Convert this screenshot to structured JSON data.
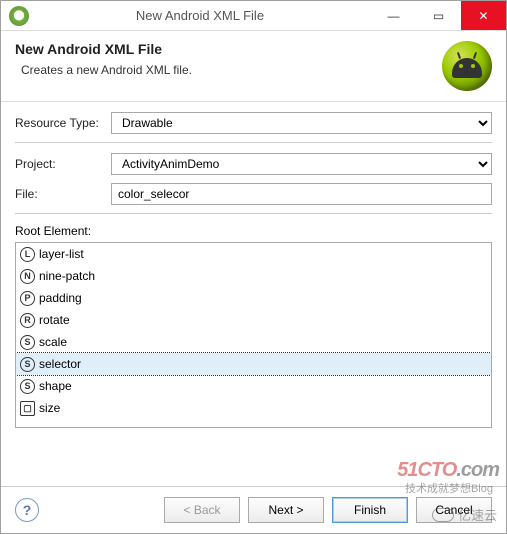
{
  "window": {
    "title": "New Android XML File",
    "controls": {
      "min": "—",
      "max": "▭",
      "close": "✕"
    }
  },
  "header": {
    "title": "New Android XML File",
    "subtitle": "Creates a new Android XML file."
  },
  "form": {
    "resource_type_label": "Resource Type:",
    "resource_type_value": "Drawable",
    "project_label": "Project:",
    "project_value": "ActivityAnimDemo",
    "file_label": "File:",
    "file_value": "color_selecor",
    "root_element_label": "Root Element:"
  },
  "root_elements": [
    {
      "badge": "L",
      "label": "layer-list",
      "selected": false
    },
    {
      "badge": "N",
      "label": "nine-patch",
      "selected": false
    },
    {
      "badge": "P",
      "label": "padding",
      "selected": false
    },
    {
      "badge": "R",
      "label": "rotate",
      "selected": false
    },
    {
      "badge": "S",
      "label": "scale",
      "selected": false
    },
    {
      "badge": "S",
      "label": "selector",
      "selected": true
    },
    {
      "badge": "S",
      "label": "shape",
      "selected": false
    },
    {
      "badge": "▢",
      "label": "size",
      "selected": false,
      "square": true
    }
  ],
  "footer": {
    "help": "?",
    "back": "< Back",
    "next": "Next >",
    "finish": "Finish",
    "cancel": "Cancel"
  },
  "watermarks": {
    "w1_a": "51CTO",
    "w1_b": ".com",
    "w2": "技术成就梦想Blog",
    "w3": "亿速云"
  }
}
